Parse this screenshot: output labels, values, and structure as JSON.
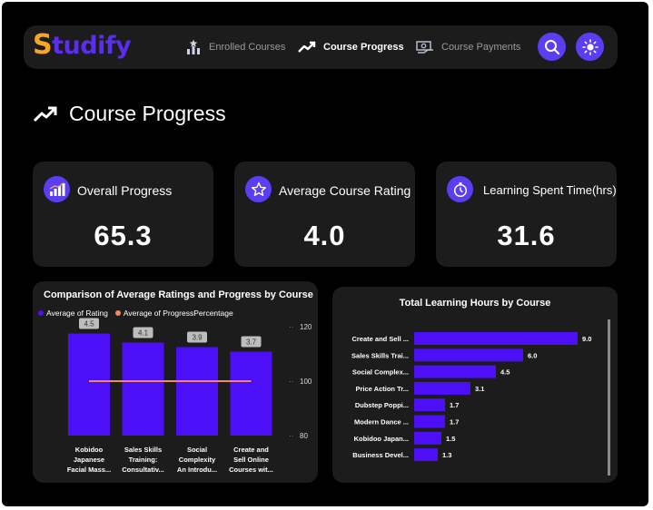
{
  "app": {
    "logo_first": "S",
    "logo_rest": "tudify"
  },
  "nav": {
    "items": [
      {
        "label": "Enrolled Courses",
        "icon": "star-bars-icon"
      },
      {
        "label": "Course Progress",
        "icon": "trend-up-icon"
      },
      {
        "label": "Course Payments",
        "icon": "money-icon"
      }
    ],
    "active": "Course Progress"
  },
  "page": {
    "title": "Course Progress"
  },
  "kpis": [
    {
      "label": "Overall Progress",
      "value": "65.3",
      "icon": "bar-chart-icon"
    },
    {
      "label": "Average Course Rating",
      "value": "4.0",
      "icon": "star-badge-icon"
    },
    {
      "label": "Learning Spent Time(hrs)",
      "value": "31.6",
      "icon": "stopwatch-icon"
    }
  ],
  "colors": {
    "accent": "#5b3df2",
    "bar": "#4d0ff5",
    "line": "#f0886a",
    "panel": "#1c1c1c"
  },
  "chart_data": [
    {
      "type": "bar",
      "title": "Comparison of Average Ratings and Progress by Course",
      "legend": [
        "Average of Rating",
        "Average of ProgressPercentage"
      ],
      "legend_colors": [
        "#4d0ff5",
        "#f0886a"
      ],
      "categories": [
        [
          "Kobidoo",
          "Japanese",
          "Facial Mass..."
        ],
        [
          "Sales Skills",
          "Training:",
          "Consultativ..."
        ],
        [
          "Social",
          "Complexity",
          "An Introdu..."
        ],
        [
          "Create and",
          "Sell Online",
          "Courses wit..."
        ]
      ],
      "series": [
        {
          "name": "Average of Rating",
          "values": [
            4.5,
            4.1,
            3.9,
            3.7
          ],
          "data_labels": [
            "4.5",
            "4.1",
            "3.9",
            "3.7"
          ]
        },
        {
          "name": "Average of ProgressPercentage",
          "values": [
            100,
            100,
            100,
            100
          ]
        }
      ],
      "ylim_left": [
        0,
        4.8
      ],
      "ylim_right": [
        80,
        120
      ],
      "right_ticks": [
        "120",
        "100",
        "80"
      ],
      "legend_position": "top-left"
    },
    {
      "type": "bar",
      "orientation": "horizontal",
      "title": "Total Learning Hours by Course",
      "categories": [
        "Create and Sell ...",
        "Sales Skills Trai...",
        "Social Complex...",
        "Price Action Tr...",
        "Dubstep Poppi...",
        "Modern Dance ...",
        "Kobidoo Japan...",
        "Business Devel..."
      ],
      "values": [
        9.0,
        6.0,
        4.5,
        3.1,
        1.7,
        1.7,
        1.5,
        1.3
      ],
      "data_labels": [
        "9.0",
        "6.0",
        "4.5",
        "3.1",
        "1.7",
        "1.7",
        "1.5",
        "1.3"
      ],
      "xlim": [
        0,
        9.6
      ]
    }
  ]
}
